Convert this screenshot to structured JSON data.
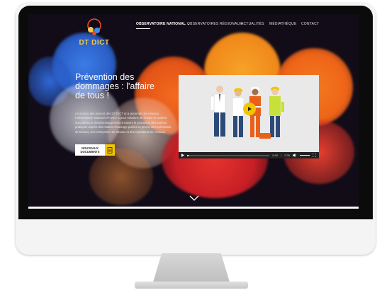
{
  "brand": {
    "name": "DT DICT"
  },
  "nav": {
    "items": [
      {
        "label": "OBSERVATOIRE NATIONAL",
        "active": true,
        "has_dropdown": true
      },
      {
        "label": "OBSERVATOIRES RÉGIONAUX",
        "active": false
      },
      {
        "label": "ACTUALITÉS",
        "active": false
      },
      {
        "label": "MÉDIATHÈQUE",
        "active": false
      },
      {
        "label": "CONTACT",
        "active": false
      }
    ]
  },
  "hero": {
    "title": "Prévention des dommages : l'affaire de tous !",
    "body": "Au service des acteurs des DT-DICT et à proximité des réseaux, l'Observatoire national DT-DICT a pour missions de réduire le nombre d'accidents et d'endommagements à travers la promotion des bonnes pratiques auprès des maîtres d'ouvrage publics et privés, des exécutants de travaux, des entreprises de travaux et des exploitants de réseaux.",
    "cta_label": "NOUVEAUX DOCUMENTS"
  },
  "video": {
    "time_current": "0:00",
    "time_total": "2:35",
    "progress": 0.02
  },
  "colors": {
    "accent": "#f2c500",
    "logo_text": "#f2c94c"
  },
  "icons": [
    "logo-mark-icon",
    "nav-dropdown-icon",
    "document-icon",
    "play-icon",
    "volume-icon",
    "fullscreen-icon",
    "chevron-down-icon"
  ]
}
